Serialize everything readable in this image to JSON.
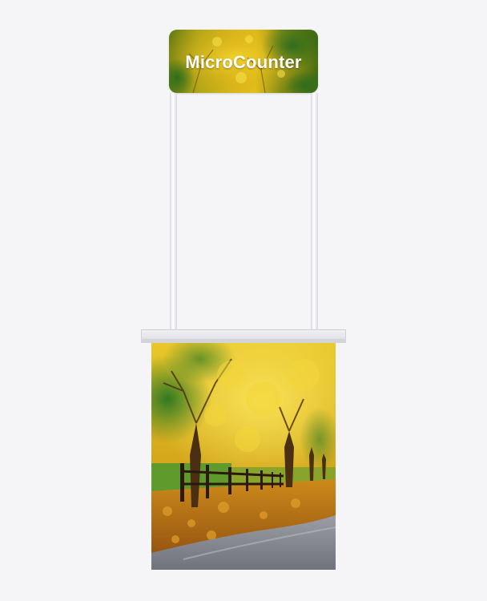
{
  "header": {
    "title": "MicroCounter"
  },
  "colors": {
    "background": "#f5f5f8",
    "pole": "#ffffff",
    "counter_top": "#e6e6ec",
    "title_text": "#ffffff"
  },
  "artwork": {
    "header_image": "autumn-foliage-image",
    "body_image": "autumn-park-path-fence-image"
  }
}
